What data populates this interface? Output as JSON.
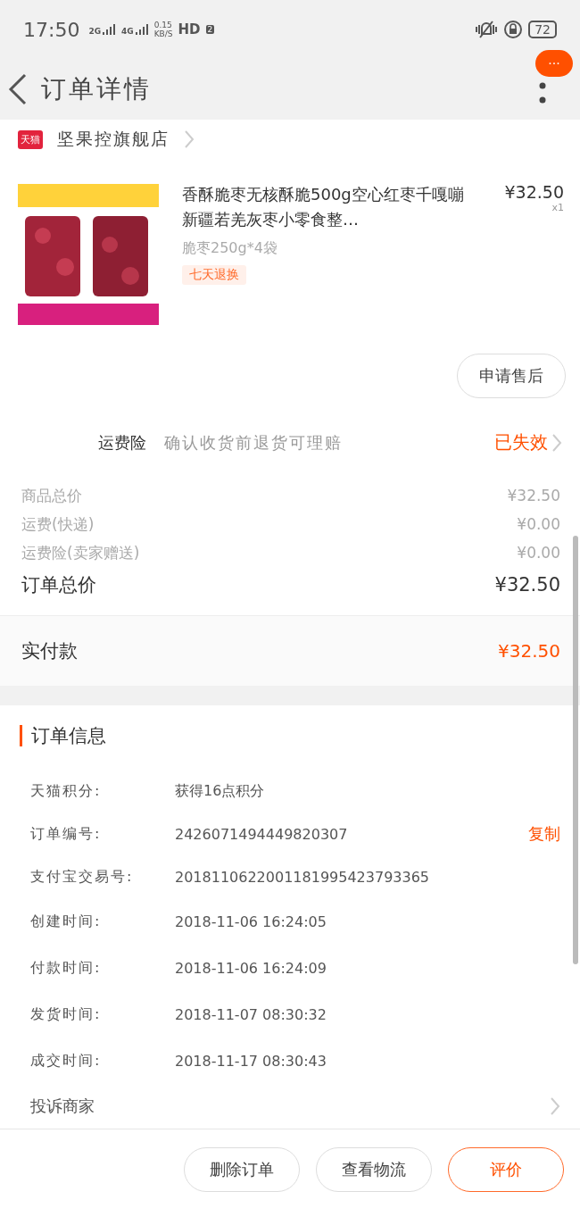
{
  "status_bar": {
    "time": "17:50",
    "sim1": "2G",
    "sim2": "4G",
    "speed_value": "0.15",
    "speed_unit": "KB/S",
    "hd": "HD",
    "hd_slot": "2",
    "battery": "72"
  },
  "header": {
    "title": "订单详情",
    "badge": "···"
  },
  "store": {
    "badge": "天猫",
    "name": "坚果控旗舰店"
  },
  "product": {
    "title": "香酥脆枣无核酥脆500g空心红枣千嘎嘣新疆若羌灰枣小零食整…",
    "variant": "脆枣250g*4袋",
    "tag": "七天退换",
    "price": "¥32.50",
    "quantity": "x1",
    "after_sale_button": "申请售后"
  },
  "insurance": {
    "label": "运费险",
    "description": "确认收货前退货可理赔",
    "status": "已失效"
  },
  "summary": [
    {
      "label": "商品总价",
      "value": "¥32.50",
      "kind": "minor"
    },
    {
      "label": "运费(快递)",
      "value": "¥0.00",
      "kind": "minor"
    },
    {
      "label": "运费险(卖家赠送)",
      "value": "¥0.00",
      "kind": "minor"
    },
    {
      "label": "订单总价",
      "value": "¥32.50",
      "kind": "total"
    }
  ],
  "paid": {
    "label": "实付款",
    "value": "¥32.50"
  },
  "order_info": {
    "title": "订单信息",
    "rows": [
      {
        "label": "天猫积分:",
        "value": "获得16点积分"
      },
      {
        "label": "订单编号:",
        "value": "2426071494449820307",
        "action": "复制"
      },
      {
        "label": "支付宝交易号:",
        "value": "2018110622001181995423793365"
      },
      {
        "label": "创建时间:",
        "value": "2018-11-06 16:24:05"
      },
      {
        "label": "付款时间:",
        "value": "2018-11-06 16:24:09"
      },
      {
        "label": "发货时间:",
        "value": "2018-11-07 08:30:32"
      },
      {
        "label": "成交时间:",
        "value": "2018-11-17 08:30:43"
      }
    ],
    "complaint": "投诉商家"
  },
  "actions": [
    {
      "label": "删除订单",
      "kind": "plain"
    },
    {
      "label": "查看物流",
      "kind": "plain"
    },
    {
      "label": "评价",
      "kind": "primary"
    }
  ]
}
